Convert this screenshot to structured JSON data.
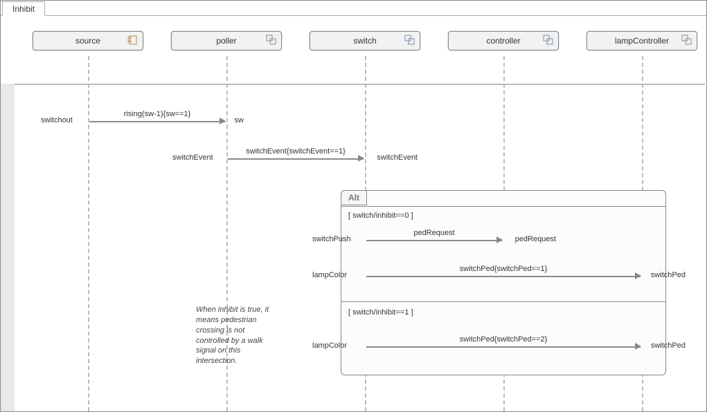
{
  "tab": {
    "title": "Inhibit"
  },
  "lifelines": [
    {
      "name": "source",
      "icon": "component"
    },
    {
      "name": "poller",
      "icon": "stereotype"
    },
    {
      "name": "switch",
      "icon": "stereotype"
    },
    {
      "name": "controller",
      "icon": "stereotype"
    },
    {
      "name": "lampController",
      "icon": "stereotype"
    }
  ],
  "messages": {
    "m1": {
      "src": "switchout",
      "dst": "sw",
      "label": "rising(sw-1){sw==1}"
    },
    "m2": {
      "src": "switchEvent",
      "dst": "switchEvent",
      "label": "switchEvent{switchEvent==1}"
    },
    "m3": {
      "src": "switchPush",
      "dst": "pedRequest",
      "label": "pedRequest"
    },
    "m4": {
      "src": "lampColor",
      "dst": "switchPed",
      "label": "switchPed{switchPed==1}"
    },
    "m5": {
      "src": "lampColor",
      "dst": "switchPed",
      "label": "switchPed{switchPed==2}"
    }
  },
  "alt": {
    "title": "Alt",
    "guard1": "[ switch/inhibit==0 ]",
    "guard2": "[ switch/inhibit==1 ]"
  },
  "note": "When inhibit is true, it means pedestrian crossing is not controlled by a walk signal on this intersection."
}
